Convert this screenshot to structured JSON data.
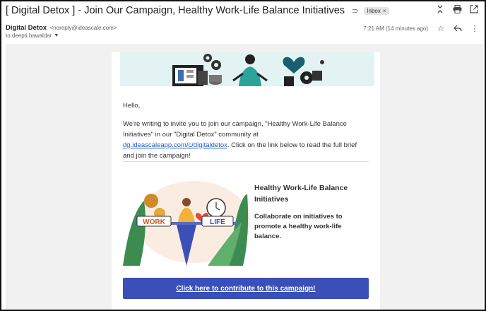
{
  "header": {
    "subject": "[ Digital Detox ] - Join Our Campaign, Healthy Work-Life Balance Initiatives",
    "inbox_label": "Inbox",
    "inbox_remove": "×"
  },
  "sender": {
    "name": "Digital Detox",
    "email": "<noreply@ideascale.com>",
    "to": "to deepti.hawaldar",
    "timestamp": "7:21 AM (14 minutes ago)"
  },
  "icons": {
    "collapse": "collapse-icon",
    "print": "printer-icon",
    "open_new": "open-new-window-icon",
    "star": "star-icon",
    "reply": "reply-icon",
    "more": "more-vertical-icon",
    "caret": "chevron-down-icon",
    "label": "label-icon"
  },
  "body": {
    "greeting": "Hello,",
    "para_1": "We're writing to invite you to join our campaign, \"Healthy Work-Life Balance Initiatives\" in our \"Digital Detox\" community at ",
    "link": "dg.ideascaleapp.com/c/digitaldetox",
    "para_2": ". Click on the link below to read the full brief and join the campaign!",
    "promo_title": "Healthy Work-Life Balance Initiatives",
    "promo_desc": "Collaborate on initiatives to promote a healthy work-life balance.",
    "image_work": "WORK",
    "image_life": "LIFE",
    "cta": "Click here to contribute to this campaign!"
  },
  "colors": {
    "cta_bg": "#3a4fb8",
    "link": "#1a5dc7",
    "banner_bg": "#e3f3f3"
  }
}
